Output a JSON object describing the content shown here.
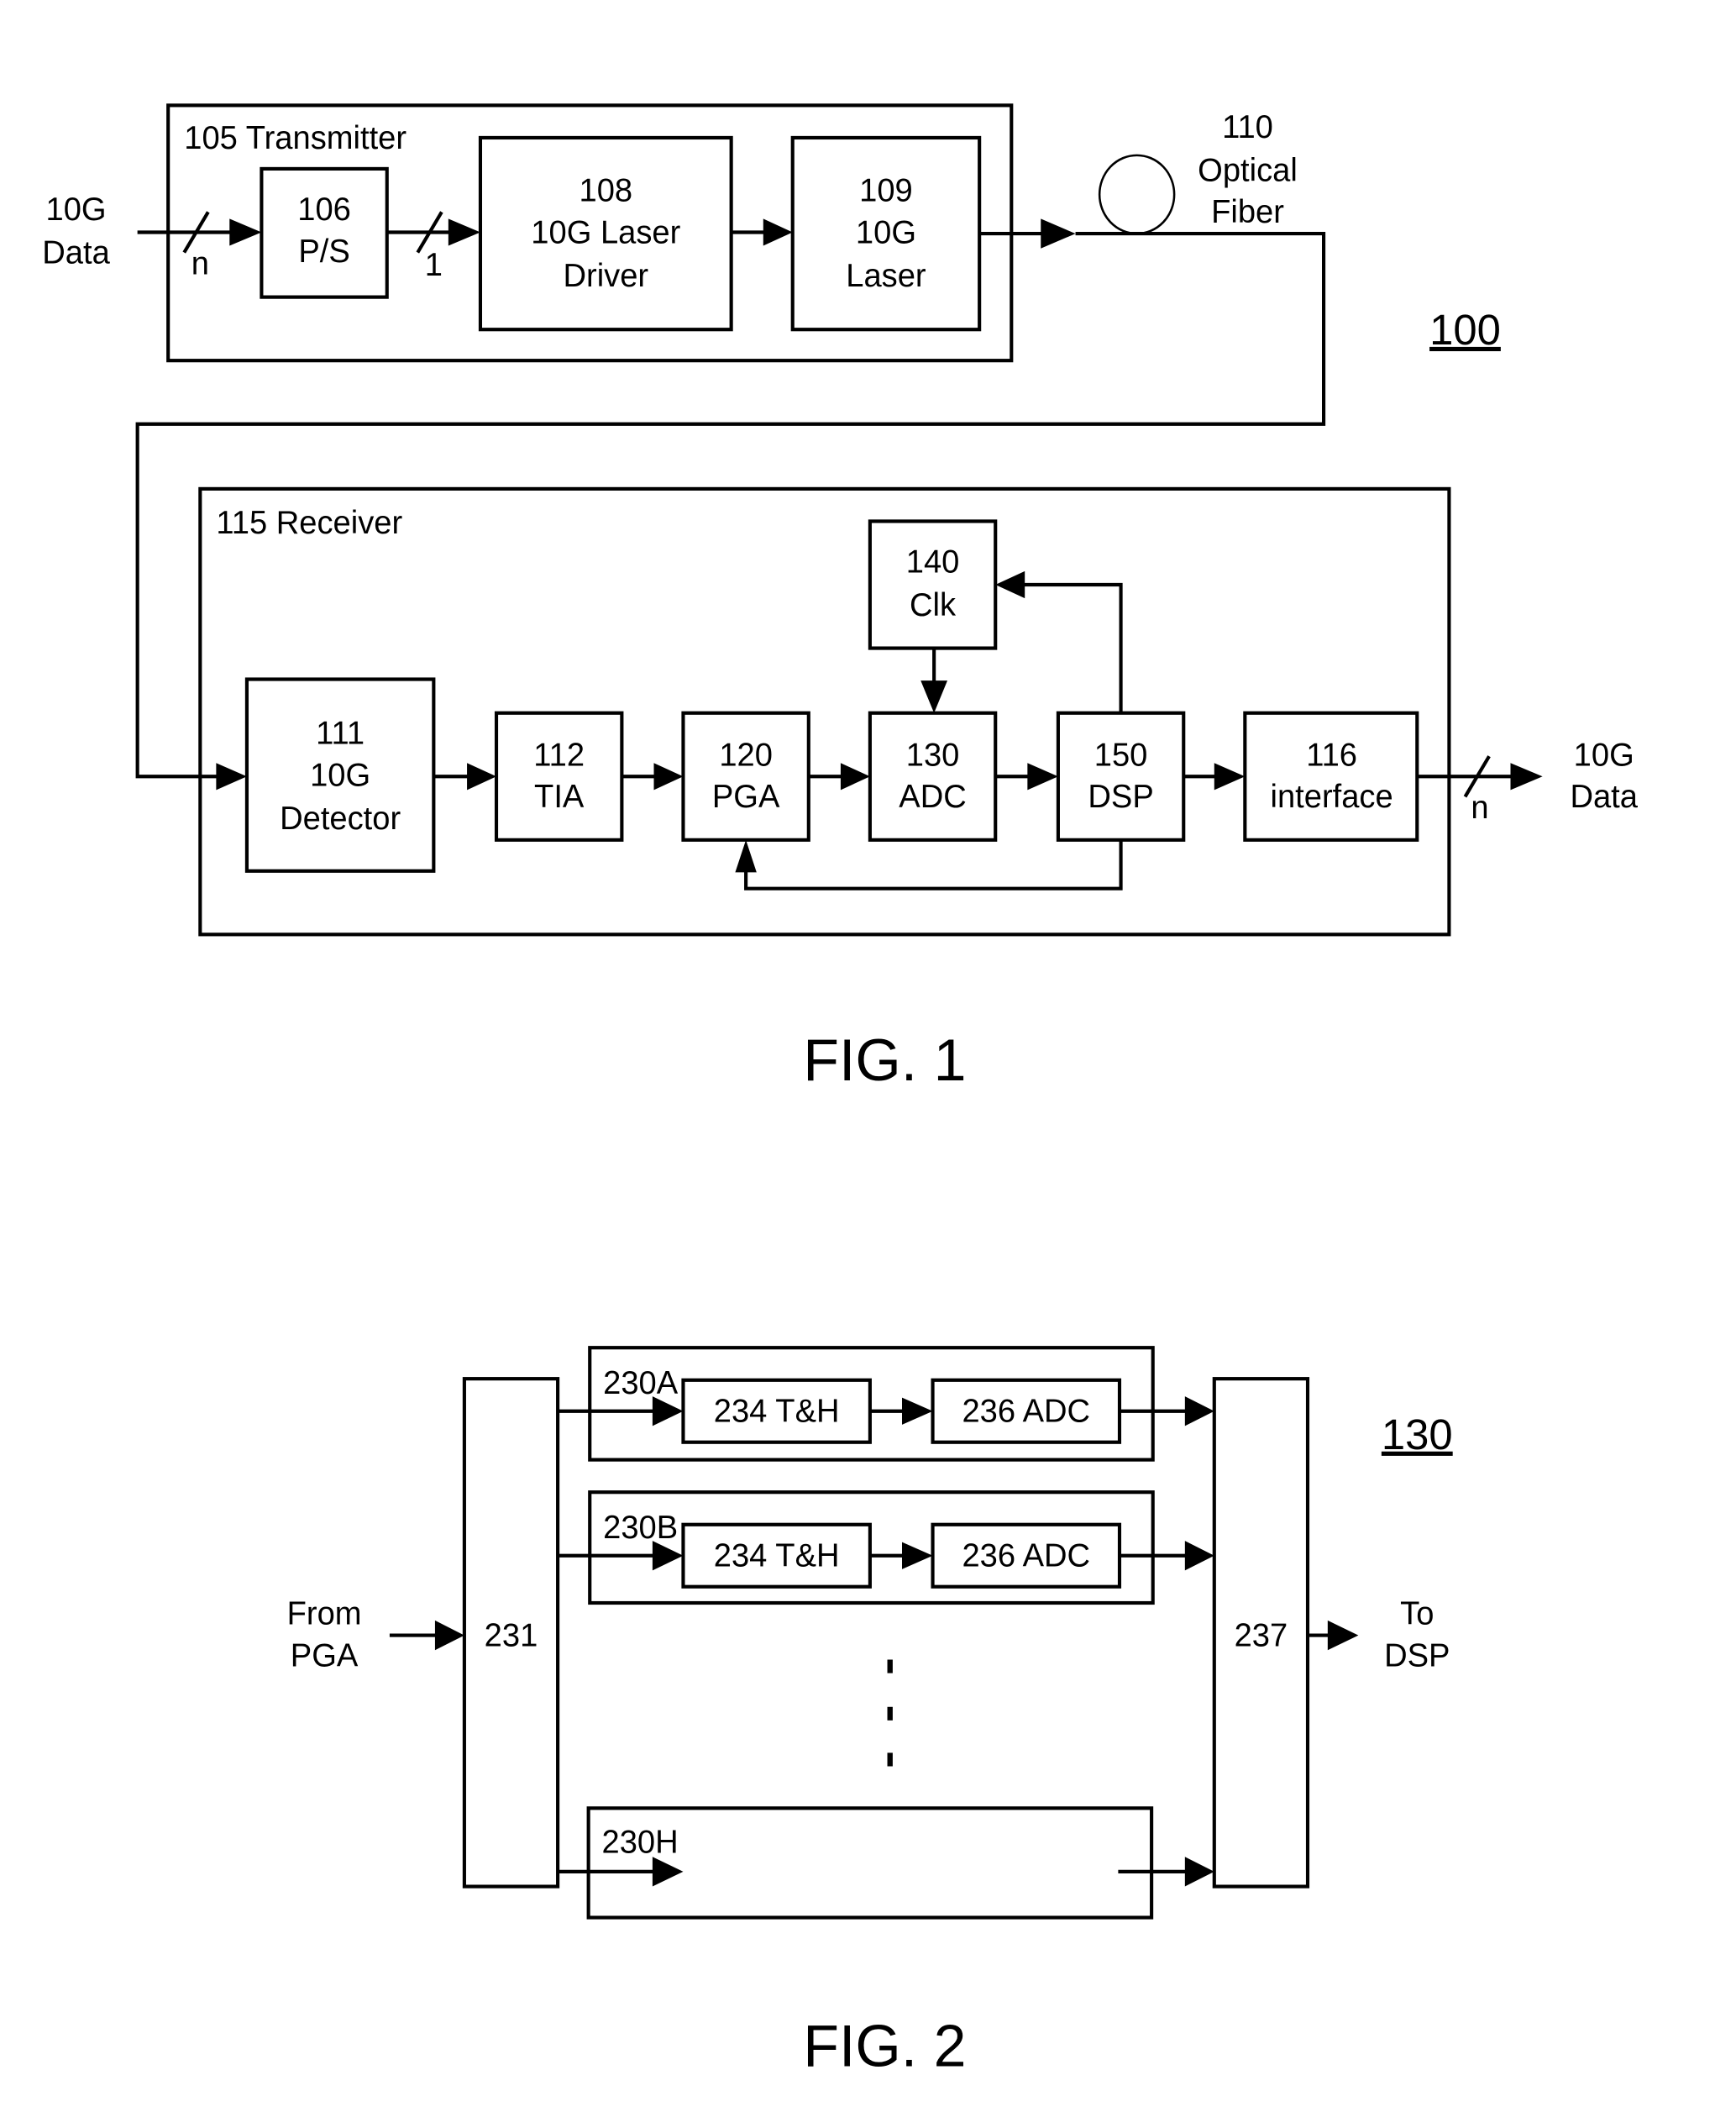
{
  "fig1": {
    "caption": "FIG. 1",
    "ref": "100",
    "input": {
      "line1": "10G",
      "line2": "Data",
      "bus": "n"
    },
    "transmitter": {
      "label": "105 Transmitter",
      "ps": {
        "line1": "106",
        "line2": "P/S"
      },
      "ps_out_bus": "1",
      "driver": {
        "line1": "108",
        "line2": "10G Laser",
        "line3": "Driver"
      },
      "laser": {
        "line1": "109",
        "line2": "10G",
        "line3": "Laser"
      }
    },
    "fiber": {
      "line1": "110",
      "line2": "Optical",
      "line3": "Fiber"
    },
    "receiver": {
      "label": "115 Receiver",
      "detector": {
        "line1": "111",
        "line2": "10G",
        "line3": "Detector"
      },
      "tia": {
        "line1": "112",
        "line2": "TIA"
      },
      "pga": {
        "line1": "120",
        "line2": "PGA"
      },
      "clk": {
        "line1": "140",
        "line2": "Clk"
      },
      "adc": {
        "line1": "130",
        "line2": "ADC"
      },
      "dsp": {
        "line1": "150",
        "line2": "DSP"
      },
      "interface": {
        "line1": "116",
        "line2": "interface"
      }
    },
    "output": {
      "line1": "10G",
      "line2": "Data",
      "bus": "n"
    }
  },
  "fig2": {
    "caption": "FIG. 2",
    "ref": "130",
    "input": {
      "line1": "From",
      "line2": "PGA"
    },
    "demux": "231",
    "mux": "237",
    "output": {
      "line1": "To",
      "line2": "DSP"
    },
    "lanes": [
      {
        "label": "230A",
        "th": "234 T&H",
        "adc": "236 ADC"
      },
      {
        "label": "230B",
        "th": "234 T&H",
        "adc": "236 ADC"
      },
      {
        "label": "230H",
        "th": "",
        "adc": ""
      }
    ]
  }
}
